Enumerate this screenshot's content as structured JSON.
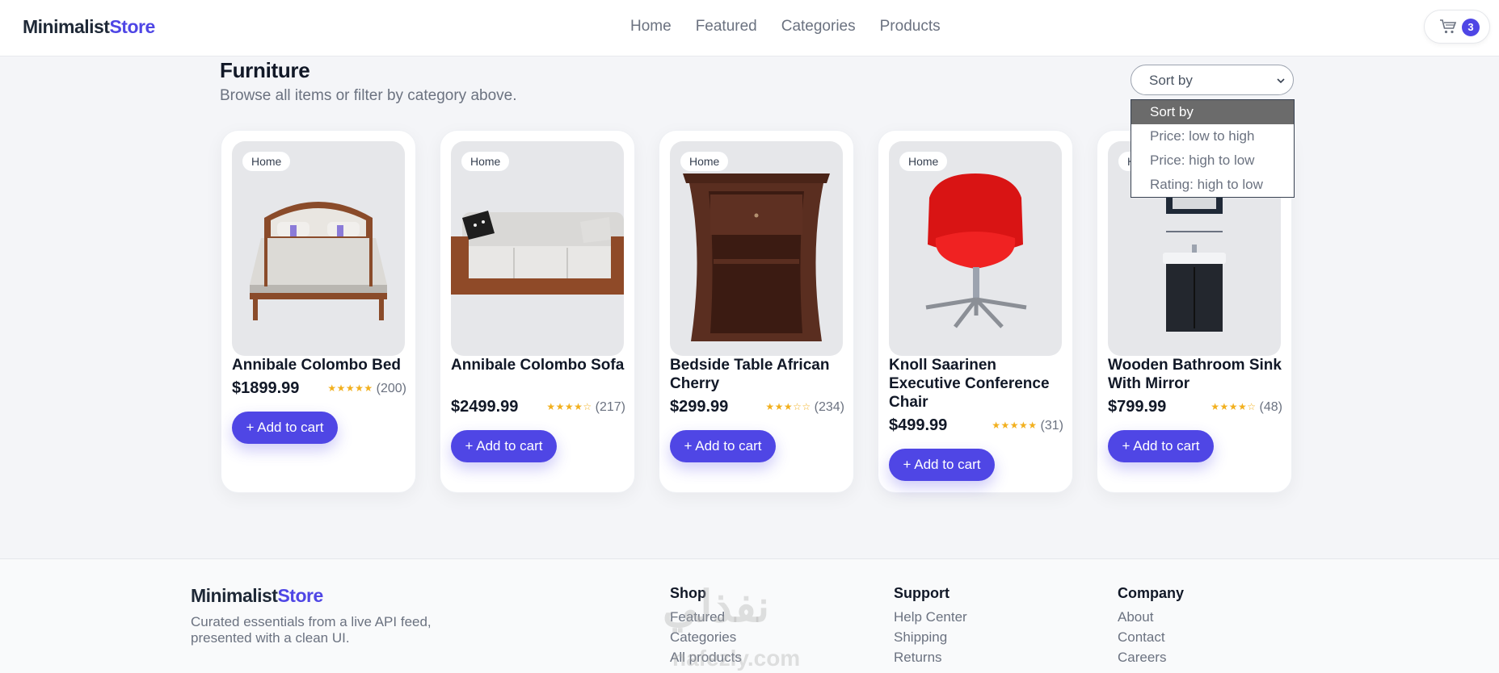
{
  "header": {
    "logo_part1": "Minimalist",
    "logo_part2": "Store",
    "nav": [
      "Home",
      "Featured",
      "Categories",
      "Products"
    ],
    "cart_count": "3"
  },
  "page": {
    "title": "Furniture",
    "subtitle": "Browse all items or filter by category above."
  },
  "sort": {
    "label": "Sort by",
    "options": [
      "Sort by",
      "Price: low to high",
      "Price: high to low",
      "Rating: high to low"
    ]
  },
  "products": [
    {
      "category": "Home",
      "name": "Annibale Colombo Bed",
      "price": "$1899.99",
      "stars": "★★★★★",
      "reviews": "(200)",
      "button": "+ Add to cart"
    },
    {
      "category": "Home",
      "name": "Annibale Colombo Sofa",
      "price": "$2499.99",
      "stars": "★★★★☆",
      "reviews": "(217)",
      "button": "+ Add to cart"
    },
    {
      "category": "Home",
      "name": "Bedside Table African Cherry",
      "price": "$299.99",
      "stars": "★★★☆☆",
      "reviews": "(234)",
      "button": "+ Add to cart"
    },
    {
      "category": "Home",
      "name": "Knoll Saarinen Executive Conference Chair",
      "price": "$499.99",
      "stars": "★★★★★",
      "reviews": "(31)",
      "button": "+ Add to cart"
    },
    {
      "category": "Home",
      "name": "Wooden Bathroom Sink With Mirror",
      "price": "$799.99",
      "stars": "★★★★☆",
      "reviews": "(48)",
      "button": "+ Add to cart"
    }
  ],
  "footer": {
    "logo_part1": "Minimalist",
    "logo_part2": "Store",
    "description": "Curated essentials from a live API feed, presented with a clean UI.",
    "columns": [
      {
        "title": "Shop",
        "links": [
          "Featured",
          "Categories",
          "All products"
        ]
      },
      {
        "title": "Support",
        "links": [
          "Help Center",
          "Shipping",
          "Returns"
        ]
      },
      {
        "title": "Company",
        "links": [
          "About",
          "Contact",
          "Careers"
        ]
      }
    ],
    "watermark_main": "نفذلي",
    "watermark_sub": "nafezly.com"
  }
}
